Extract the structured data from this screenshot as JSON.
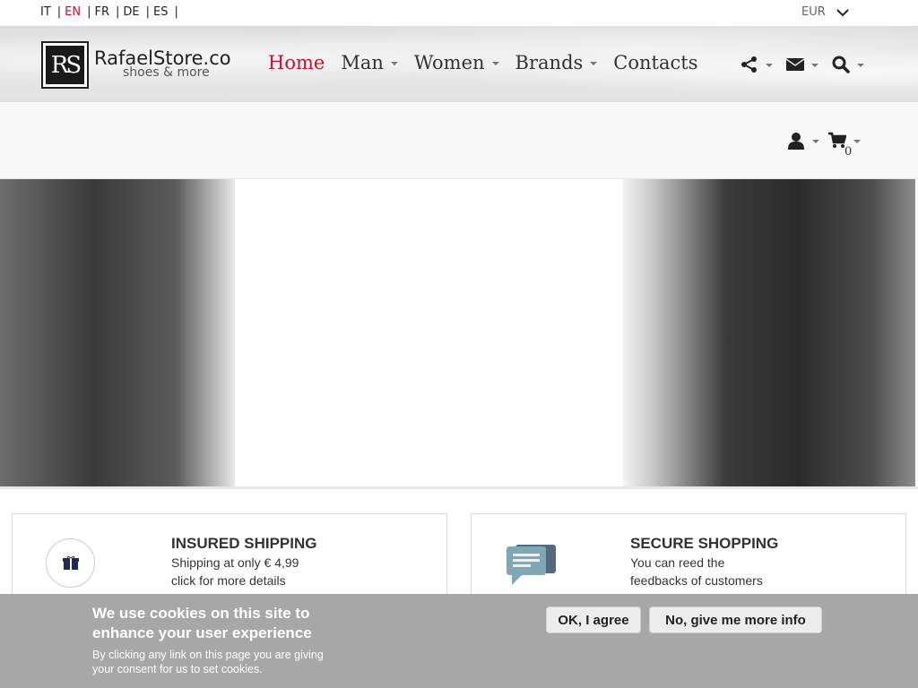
{
  "languages": [
    {
      "code": "IT",
      "active": false
    },
    {
      "code": "EN",
      "active": true
    },
    {
      "code": "FR",
      "active": false
    },
    {
      "code": "DE",
      "active": false
    },
    {
      "code": "ES",
      "active": false
    }
  ],
  "lang_separator": "|",
  "currency": "EUR",
  "logo": {
    "mark": "RS",
    "name": "RafaelStore.com",
    "tagline": "shoes & more"
  },
  "nav": [
    {
      "label": "Home",
      "active": true,
      "dropdown": false
    },
    {
      "label": "Man",
      "active": false,
      "dropdown": true
    },
    {
      "label": "Women",
      "active": false,
      "dropdown": true
    },
    {
      "label": "Brands",
      "active": false,
      "dropdown": true
    },
    {
      "label": "Contacts",
      "active": false,
      "dropdown": false
    }
  ],
  "header_icons": [
    "share-icon",
    "envelope-icon",
    "search-icon"
  ],
  "account_icons": [
    "user-icon",
    "cart-icon"
  ],
  "cart_count": "0",
  "features": [
    {
      "icon": "gift-box-icon",
      "title": "INSURED SHIPPING",
      "line1": "Shipping at only € 4,99",
      "line2": "click for more details"
    },
    {
      "icon": "chat-bubbles-icon",
      "title": "SECURE SHOPPING",
      "line1": "You can reed the",
      "line2": "feedbacks of customers"
    }
  ],
  "cookie": {
    "title": "We use cookies on this site to enhance your user experience",
    "body": "By clicking any link on this page you are giving your consent for us to set cookies.",
    "agree": "OK, I agree",
    "more": "No, give me more info"
  },
  "colors": {
    "accent": "#c8102e",
    "text": "#222222",
    "cookie_bg": "#a0a0a0"
  }
}
